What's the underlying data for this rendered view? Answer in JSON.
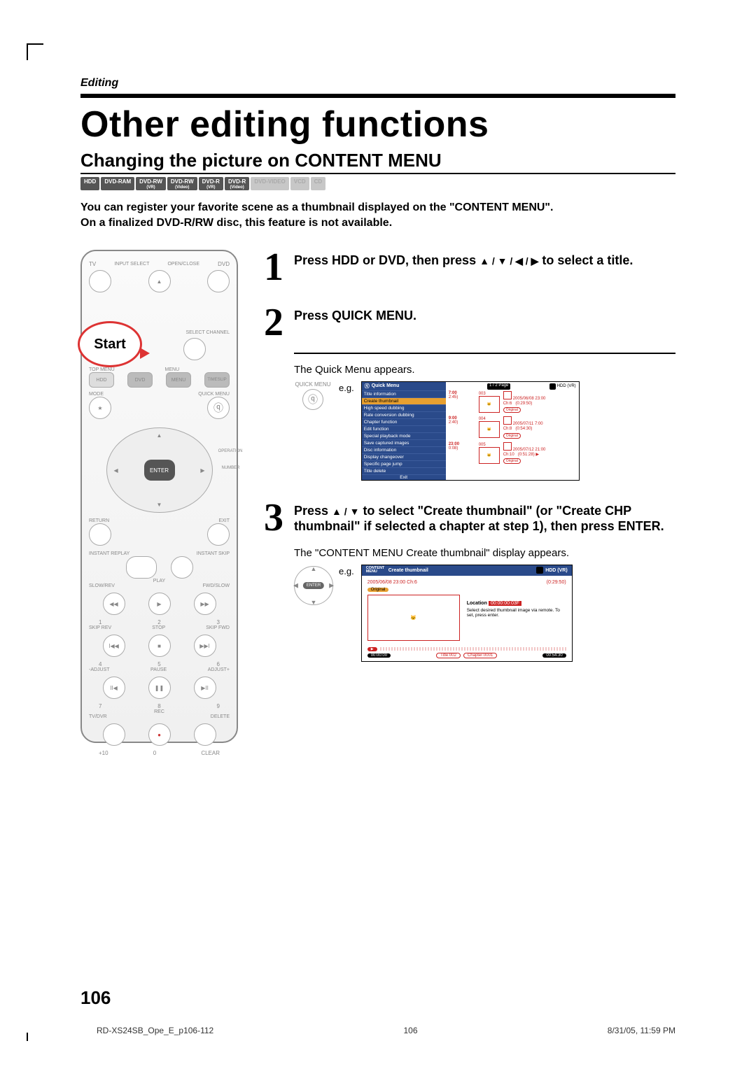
{
  "header": {
    "section_tag": "Editing",
    "title": "Other editing functions",
    "subtitle": "Changing the picture on CONTENT MENU"
  },
  "disc_badges": {
    "enabled": [
      "HDD",
      "DVD-RAM",
      "DVD-RW (VR)",
      "DVD-RW (Video)",
      "DVD-R (VR)",
      "DVD-R (Video)"
    ],
    "disabled": [
      "DVD-VIDEO",
      "VCD",
      "CD"
    ]
  },
  "intro": {
    "line1": "You can register your favorite scene as a thumbnail displayed on the \"CONTENT MENU\".",
    "line2": "On a finalized DVD-R/RW disc, this feature is not available."
  },
  "remote": {
    "start_label": "Start",
    "tv": "TV",
    "dvd": "DVD",
    "input_select": "INPUT SELECT",
    "open_close": "OPEN/CLOSE",
    "select_channel": "SELECT CHANNEL",
    "top_menu": "TOP MENU",
    "menu": "MENU",
    "hdd": "HDD",
    "dvd_btn": "DVD",
    "timeslip": "TIMESLIP",
    "mode": "MODE",
    "quick_menu": "QUICK MENU",
    "enter": "ENTER",
    "operation": "OPERATION",
    "number": "NUMBER",
    "return": "RETURN",
    "exit": "EXIT",
    "instant_replay": "INSTANT REPLAY",
    "instant_skip": "INSTANT SKIP",
    "play": "PLAY",
    "slow_rev": "SLOW/REV",
    "fwd_slow": "FWD/SLOW",
    "skip_rev": "SKIP REV",
    "stop": "STOP",
    "skip_fwd": "SKIP FWD",
    "adjust_minus": "-ADJUST",
    "pause": "PAUSE",
    "adjust_plus": "ADJUST+",
    "rec": "REC",
    "tv_dvr": "TV/DVR",
    "delete": "DELETE",
    "plus10": "+10",
    "clear": "CLEAR",
    "numpad": [
      "1",
      "2",
      "3",
      "4",
      "5",
      "6",
      "7",
      "8",
      "9",
      "0"
    ]
  },
  "steps": {
    "s1": {
      "num": "1",
      "title_a": "Press HDD or DVD, then press ",
      "title_b": " to select a title."
    },
    "s2": {
      "num": "2",
      "title": "Press QUICK MENU.",
      "sub": "The Quick Menu appears.",
      "icon_label": "QUICK MENU",
      "eg": "e.g.",
      "osd": {
        "menu_header": "Quick Menu",
        "page_indicator": "1 / 2 Page",
        "hdd_label": "HDD (VR)",
        "items": [
          "Title information",
          "Create thumbnail",
          "High speed dubbing",
          "Rate conversion dubbing",
          "Chapter function",
          "Edit function",
          "Special playback mode",
          "Save captured images",
          "Disc information",
          "Display changeover",
          "Specific page jump",
          "Title delete"
        ],
        "selected_index": 1,
        "exit": "Exit",
        "entries": [
          {
            "time": "7:00",
            "dur": "2:45)",
            "idx": "003",
            "date": "2005/06/08 23:00",
            "ch": "Ch:6",
            "len": "(0:29:50)",
            "orig": "Original"
          },
          {
            "time": "9:00",
            "dur": "2:40)",
            "idx": "004",
            "date": "2005/07/11 7:00",
            "ch": "Ch:8",
            "len": "(0:54:30)",
            "orig": "Original"
          },
          {
            "time": "23:00",
            "dur": "0:08)",
            "idx": "005",
            "date": "2005/07/12 21:00",
            "ch": "Ch:10",
            "len": "(0:51:28)",
            "orig": "Original"
          }
        ]
      }
    },
    "s3": {
      "num": "3",
      "title_a": "Press ",
      "title_b": " to select \"Create thumbnail\" (or \"Create CHP thumbnail\" if selected a chapter at step 1), then press ENTER.",
      "sub": "The \"CONTENT MENU Create thumbnail\" display appears.",
      "eg": "e.g.",
      "dpad_enter": "ENTER",
      "osd": {
        "left_small": "CONTENT MENU",
        "titlebar": "Create thumbnail",
        "hdd_label": "HDD (VR)",
        "date": "2005/06/08 23:00  Ch:6",
        "len": "(0:29:50)",
        "orig": "Original",
        "loc_label": "Location",
        "loc_value": "00:00:00:03F",
        "hint": "Select desired thumbnail image via remote. To set, press enter.",
        "bar_left": "00:00:00",
        "bar_title": "Title:002",
        "bar_chapter": "Chapter:0001",
        "bar_right": "00:54:30"
      }
    }
  },
  "page_number": "106",
  "footer": {
    "left": "RD-XS24SB_Ope_E_p106-112",
    "center": "106",
    "right": "8/31/05, 11:59 PM"
  }
}
